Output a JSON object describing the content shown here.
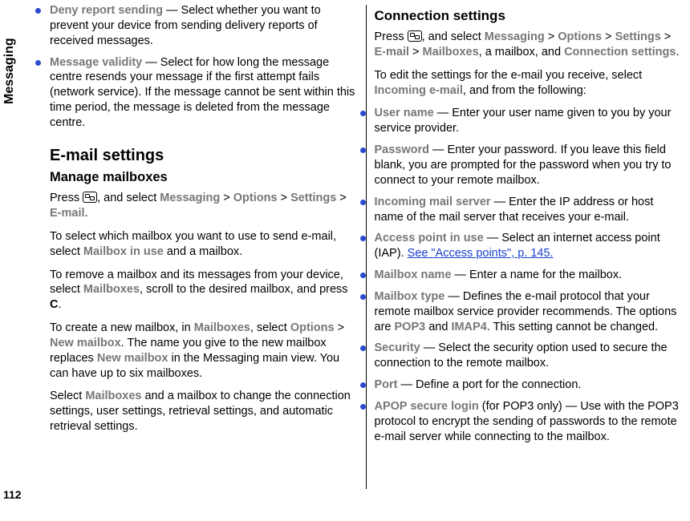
{
  "side_tab": "Messaging",
  "page_number": "112",
  "left": {
    "bullets1": [
      {
        "term": "Deny report sending",
        "body": " — Select whether you want to prevent your device from sending delivery reports of received messages."
      },
      {
        "term": "Message validity",
        "body": " — Select for how long the message centre resends your message if the first attempt fails (network service). If the message cannot be sent within this time period, the message is deleted from the message centre."
      }
    ],
    "h2": "E-mail settings",
    "h3": "Manage mailboxes",
    "p1_a": "Press ",
    "p1_b": ", and select ",
    "p1_path": [
      "Messaging",
      "Options",
      "Settings",
      "E-mail"
    ],
    "p2_a": "To select which mailbox you want to use to send e-mail, select ",
    "p2_term": "Mailbox in use",
    "p2_b": " and a mailbox.",
    "p3_a": "To remove a mailbox and its messages from your device, select ",
    "p3_term": "Mailboxes",
    "p3_b": ", scroll to the desired mailbox, and press ",
    "p3_key": "C",
    "p3_c": ".",
    "p4_a": "To create a new mailbox, in ",
    "p4_t1": "Mailboxes",
    "p4_b": ", select ",
    "p4_t2": "Options",
    "p4_gt": " > ",
    "p4_t3": "New mailbox",
    "p4_c": ". The name you give to the new mailbox replaces ",
    "p4_t4": "New mailbox",
    "p4_d": " in the Messaging main view. You can have up to six mailboxes.",
    "p5_a": "Select ",
    "p5_t": "Mailboxes",
    "p5_b": " and a mailbox to change the connection settings, user settings, retrieval settings, and automatic retrieval settings."
  },
  "right": {
    "h3": "Connection settings",
    "p1_a": "Press ",
    "p1_b": ", and select ",
    "p1_path": [
      "Messaging",
      "Options",
      "Settings",
      "E-mail",
      "Mailboxes"
    ],
    "p1_c": ", a mailbox, and ",
    "p1_t": "Connection settings",
    "p1_d": ".",
    "p2_a": "To edit the settings for the e-mail you receive, select ",
    "p2_t": "Incoming e-mail",
    "p2_b": ", and from the following:",
    "bullets": [
      {
        "term": "User name",
        "body": " — Enter your user name given to you by your service provider."
      },
      {
        "term": "Password",
        "body": " — Enter your password. If you leave this field blank, you are prompted for the password when you try to connect to your remote mailbox."
      },
      {
        "term": "Incoming mail server",
        "body": " — Enter the IP address or host name of the mail server that receives your e-mail."
      },
      {
        "term": "Access point in use",
        "body": " — Select an internet access point (IAP). ",
        "link": "See \"Access points\", p. 145."
      },
      {
        "term": "Mailbox name",
        "body": " — Enter a name for the mailbox."
      },
      {
        "term": "Mailbox type",
        "body": " — Defines the e-mail protocol that your remote mailbox service provider recommends. The options are ",
        "opt1": "POP3",
        "mid": " and ",
        "opt2": "IMAP4",
        "tail": ". This setting cannot be changed."
      },
      {
        "term": "Security",
        "body": " — Select the security option used to secure the connection to the remote mailbox."
      },
      {
        "term": "Port",
        "body": " — Define a port for the connection."
      },
      {
        "term": "APOP secure login",
        "body": " (for POP3 only) — Use with the POP3 protocol to encrypt the sending of passwords to the remote e-mail server while connecting to the mailbox."
      }
    ]
  }
}
